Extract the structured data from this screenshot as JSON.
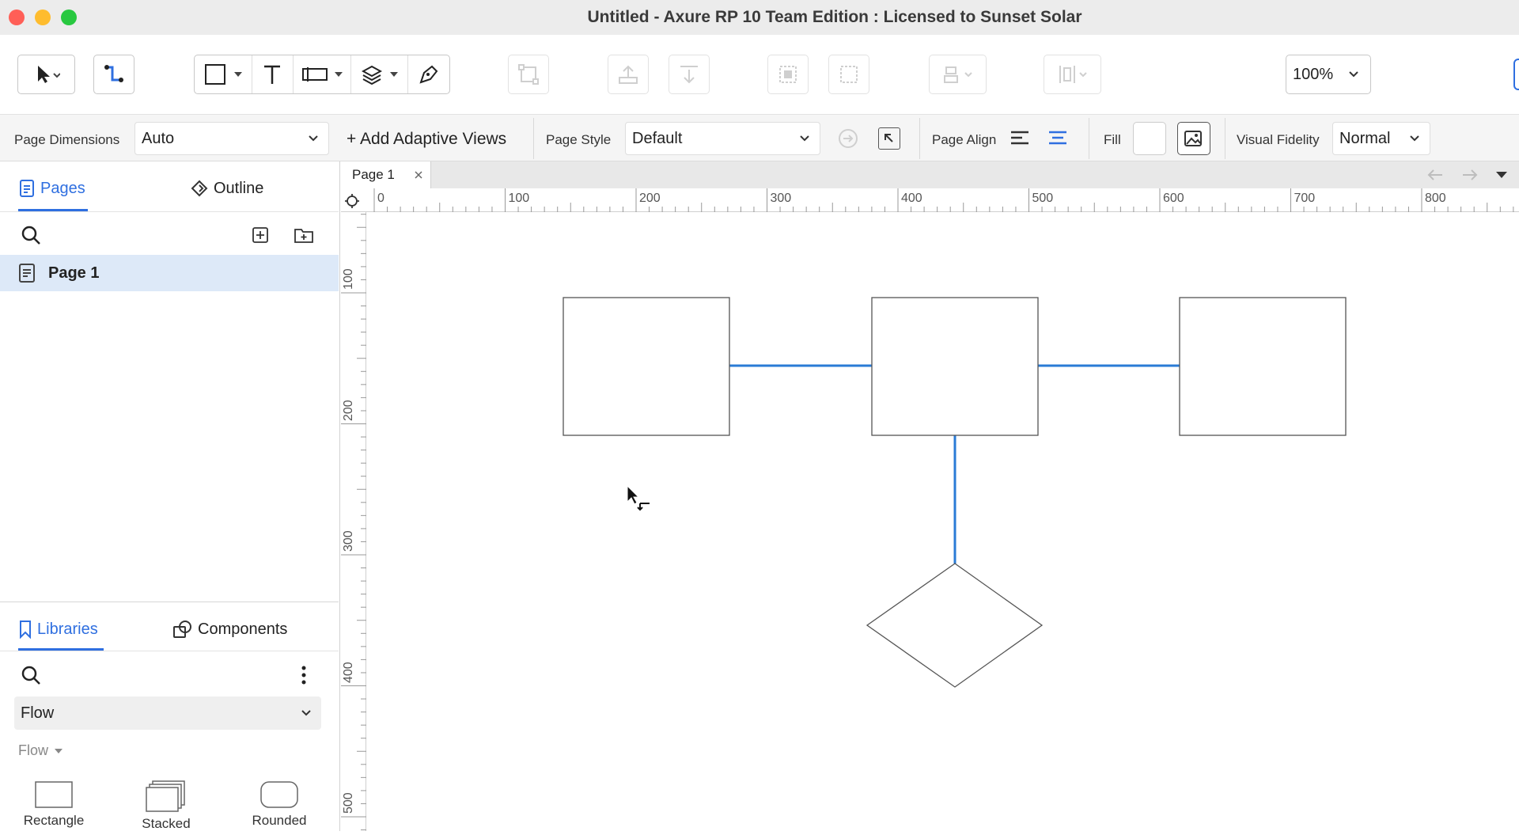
{
  "window": {
    "title": "Untitled - Axure RP 10 Team Edition : Licensed to Sunset Solar"
  },
  "toolbar": {
    "zoom": "100%",
    "tools": [
      "pointer-icon",
      "connector-icon",
      "rectangle-shape-icon",
      "text-icon",
      "field-icon",
      "layers-icon",
      "pen-icon",
      "path-icon",
      "bring-front-icon",
      "send-back-icon",
      "group-icon",
      "ungroup-icon",
      "align-icon",
      "distribute-icon"
    ]
  },
  "stylebar": {
    "page_dimensions_label": "Page Dimensions",
    "page_dimensions_value": "Auto",
    "add_adaptive_views": "+ Add Adaptive Views",
    "page_style_label": "Page Style",
    "page_style_value": "Default",
    "page_align_label": "Page Align",
    "fill_label": "Fill",
    "visual_fidelity_label": "Visual Fidelity",
    "visual_fidelity_value": "Normal"
  },
  "left_panel": {
    "tabs": {
      "pages": "Pages",
      "outline": "Outline"
    },
    "pages": [
      {
        "label": "Page 1",
        "selected": true
      }
    ],
    "library_tabs": {
      "libraries": "Libraries",
      "components": "Components"
    },
    "library_select": "Flow",
    "library_group": "Flow",
    "widgets": [
      "Rectangle",
      "Stacked",
      "Rounded"
    ]
  },
  "canvas": {
    "tab_label": "Page 1",
    "ruler_h": [
      "0",
      "100",
      "200",
      "300",
      "400",
      "500",
      "600",
      "700",
      "800"
    ],
    "ruler_v": [
      "100",
      "200",
      "300",
      "400",
      "500"
    ]
  },
  "colors": {
    "accent": "#2f6fe0",
    "connector": "#2a7bd6",
    "selected_row": "#dde9f8"
  }
}
